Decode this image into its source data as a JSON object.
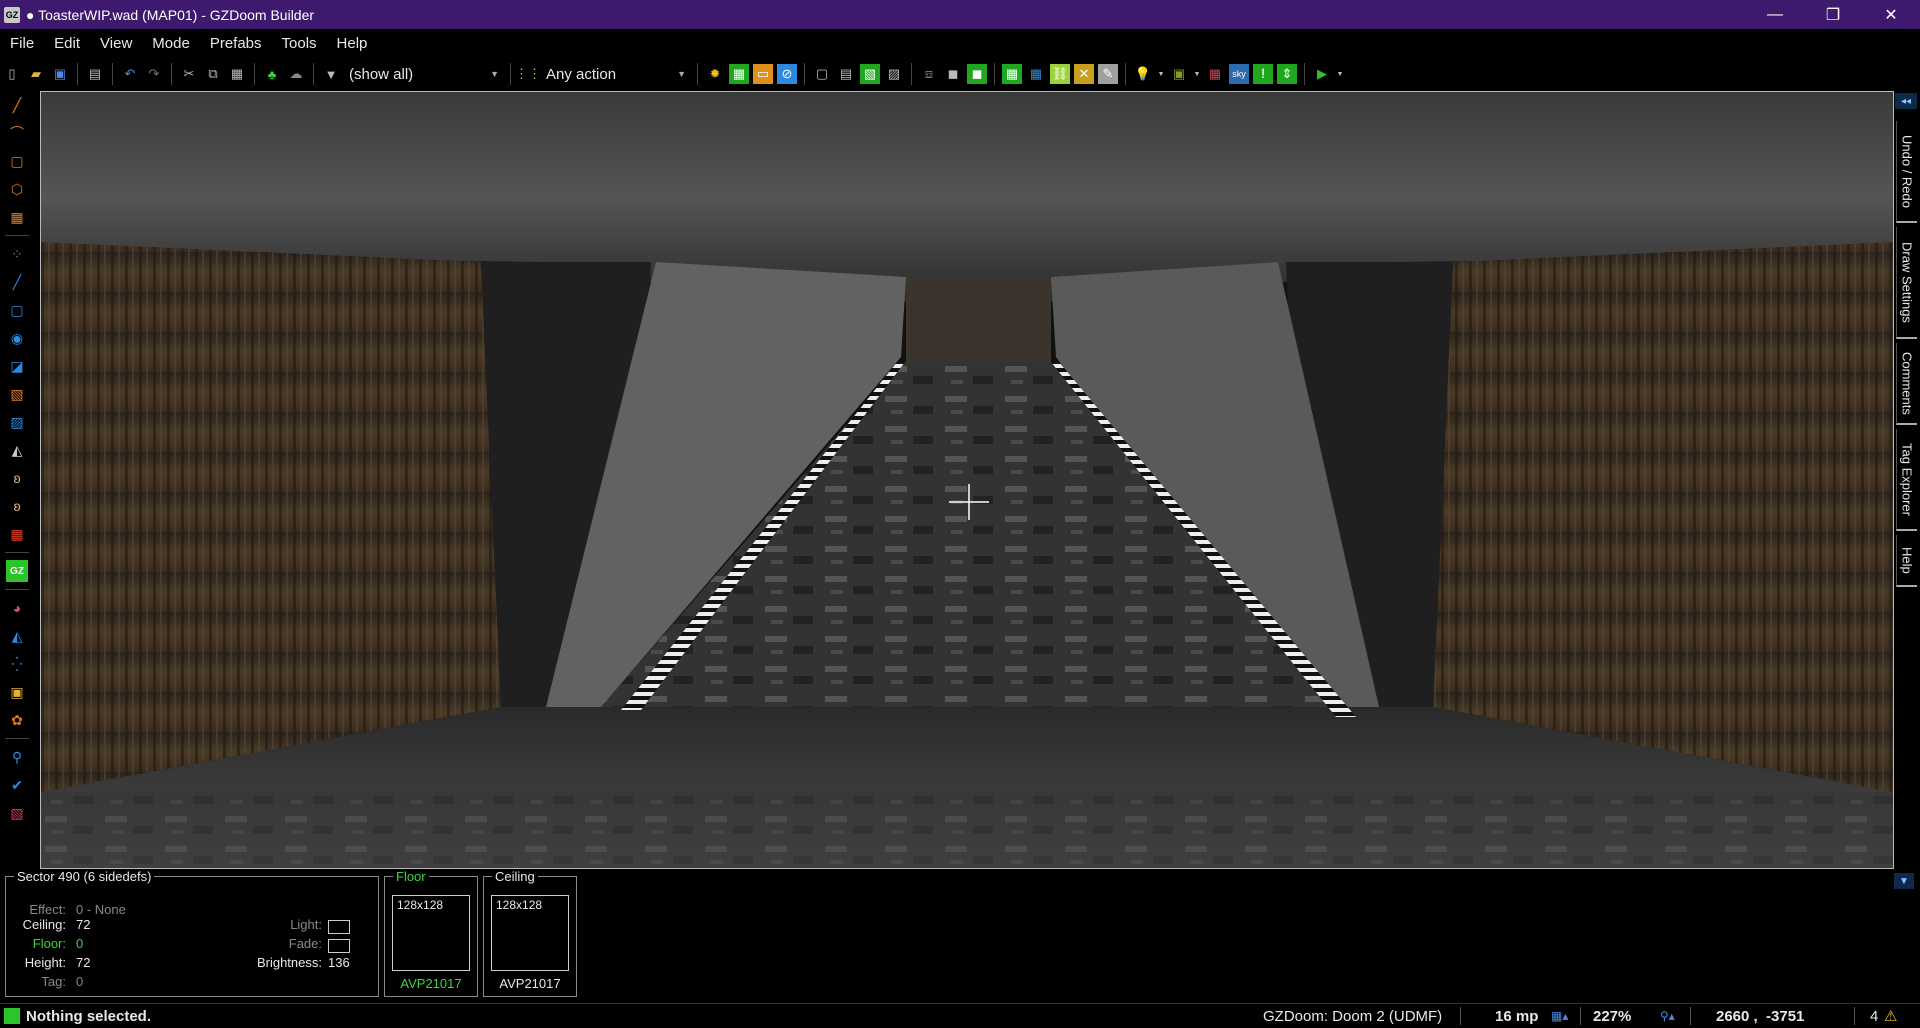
{
  "window": {
    "title": "● ToasterWIP.wad (MAP01) - GZDoom Builder",
    "app_icon": "GZ",
    "minimize": "—",
    "restore": "❐",
    "close": "✕"
  },
  "menu": [
    "File",
    "Edit",
    "View",
    "Mode",
    "Prefabs",
    "Tools",
    "Help"
  ],
  "toolbar": {
    "filter_value": "(show all)",
    "action_value": "Any action"
  },
  "right_dock": {
    "tabs": [
      "Undo / Redo",
      "Draw Settings",
      "Comments",
      "Tag Explorer",
      "Help"
    ]
  },
  "sector_panel": {
    "legend": "Sector 490 (6 sidedefs)",
    "effect_label": "Effect:",
    "effect_value": "0 - None",
    "ceiling_label": "Ceiling:",
    "ceiling_value": "72",
    "floor_label": "Floor:",
    "floor_value": "0",
    "height_label": "Height:",
    "height_value": "72",
    "tag_label": "Tag:",
    "tag_value": "0",
    "light_label": "Light:",
    "fade_label": "Fade:",
    "brightness_label": "Brightness:",
    "brightness_value": "136"
  },
  "floor_panel": {
    "legend": "Floor",
    "size": "128x128",
    "texture": "AVP21017"
  },
  "ceiling_panel": {
    "legend": "Ceiling",
    "size": "128x128",
    "texture": "AVP21017"
  },
  "statusbar": {
    "message": "Nothing selected.",
    "engine": "GZDoom: Doom 2 (UDMF)",
    "grid": "16 mp",
    "zoom": "227%",
    "coords": "2660 ,  -3751",
    "warnings": "4"
  },
  "colors": {
    "titlebar": "#3d1a6e",
    "accent_green": "#2bc42b",
    "floor_green": "#3bd63b"
  }
}
